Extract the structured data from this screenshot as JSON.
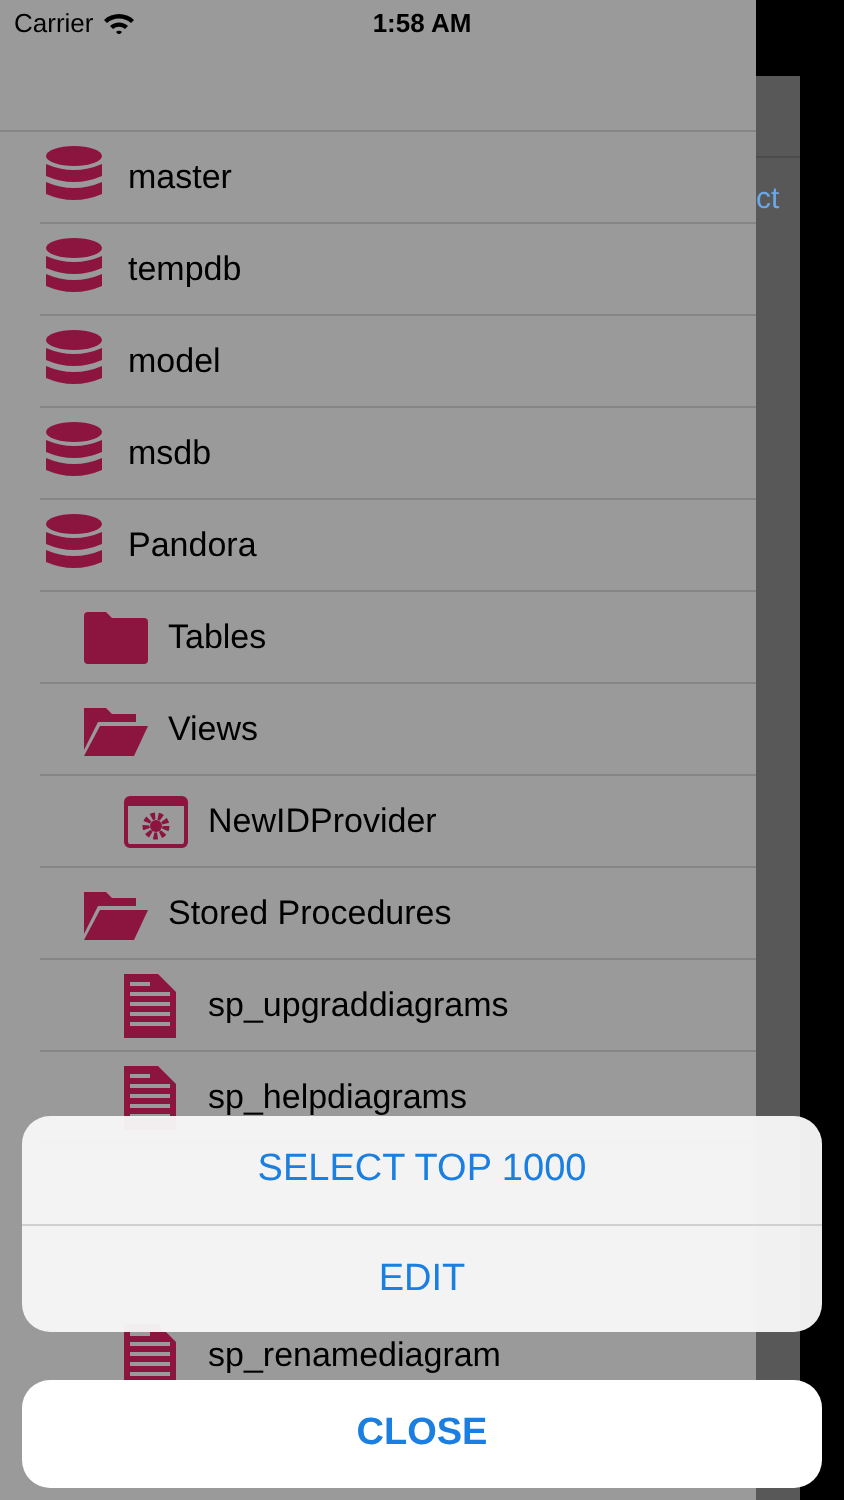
{
  "status_bar": {
    "carrier": "Carrier",
    "time": "1:58 AM"
  },
  "back_screen": {
    "partial_text": "ct"
  },
  "tree": [
    {
      "kind": "database",
      "label": "master"
    },
    {
      "kind": "database",
      "label": "tempdb"
    },
    {
      "kind": "database",
      "label": "model"
    },
    {
      "kind": "database",
      "label": "msdb"
    },
    {
      "kind": "database",
      "label": "Pandora",
      "children": [
        {
          "kind": "folder",
          "label": "Tables",
          "expanded": false
        },
        {
          "kind": "folder",
          "label": "Views",
          "expanded": true,
          "children": [
            {
              "kind": "view",
              "label": "NewIDProvider"
            }
          ]
        },
        {
          "kind": "folder",
          "label": "Stored Procedures",
          "expanded": true,
          "children": [
            {
              "kind": "procedure",
              "label": "sp_upgraddiagrams"
            },
            {
              "kind": "procedure",
              "label": "sp_helpdiagrams"
            }
          ]
        }
      ]
    }
  ],
  "tree_continued": [
    {
      "kind": "procedure",
      "label": "sp_renamediagram"
    }
  ],
  "action_sheet": {
    "actions": [
      "SELECT TOP 1000",
      "EDIT"
    ],
    "cancel": "CLOSE"
  }
}
